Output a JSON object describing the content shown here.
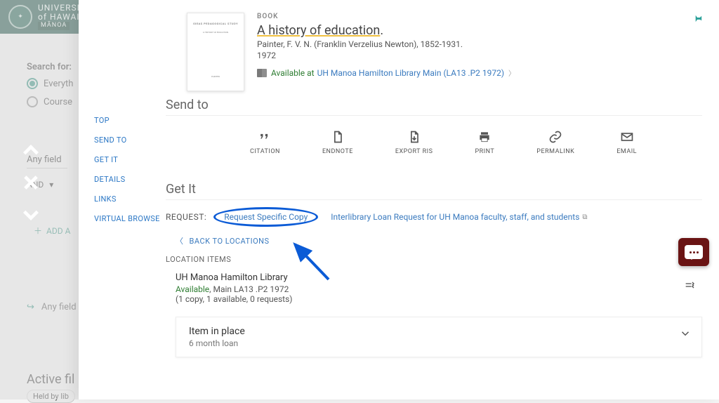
{
  "bg": {
    "university_top": "UNIVERSITY",
    "university_bottom": "of HAWAI",
    "campus": "MĀNOA",
    "search_label": "Search for:",
    "scope_everything": "Everyth",
    "scope_course": "Course",
    "anyfield": "Any field",
    "and": "AND",
    "add_line": "ADD A",
    "anyfield2": "Any field",
    "active_filters": "Active fil",
    "chip": "Held by lib"
  },
  "nav": {
    "top": "TOP",
    "sendto": "SEND TO",
    "getit": "GET IT",
    "details": "DETAILS",
    "links": "LINKS",
    "vb": "VIRTUAL BROWSE"
  },
  "record": {
    "kind": "BOOK",
    "title": "A history of education",
    "title_suffix": ".",
    "author": "Painter, F. V. N. (Franklin Verzelius Newton), 1852-1931.",
    "year": "1972",
    "avail_prefix": "Available at",
    "avail_loc": "UH Manoa Hamilton Library  Main (LA13 .P2 1972)"
  },
  "sendto": {
    "heading": "Send to",
    "citation": "CITATION",
    "endnote": "ENDNOTE",
    "exportris": "EXPORT RIS",
    "print": "PRINT",
    "permalink": "PERMALINK",
    "email": "EMAIL"
  },
  "getit": {
    "heading": "Get It",
    "request_label": "REQUEST:",
    "req_specific": "Request Specific Copy",
    "ill": "Interlibrary Loan Request for UH Manoa faculty, staff, and students",
    "back": "BACK TO LOCATIONS",
    "loc_items": "LOCATION ITEMS",
    "libname": "UH Manoa Hamilton Library",
    "available": "Available",
    "callno": ", Main LA13 .P2 1972",
    "copies": "(1 copy, 1 available, 0 requests)",
    "item_status": "Item in place",
    "loan_policy": "6 month loan"
  }
}
